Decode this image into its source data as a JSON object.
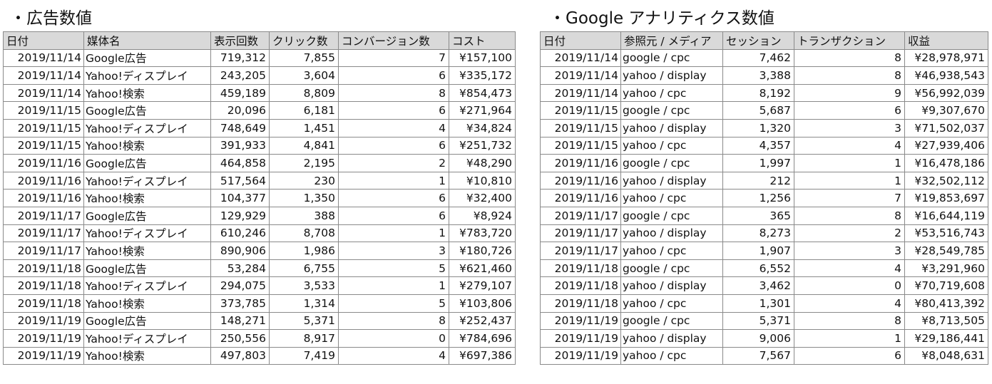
{
  "ads": {
    "title": "・広告数値",
    "headers": [
      "日付",
      "媒体名",
      "表示回数",
      "クリック数",
      "コンバージョン数",
      "コスト"
    ],
    "rows": [
      [
        "2019/11/14",
        "Google広告",
        "719,312",
        "7,855",
        "7",
        "¥157,100"
      ],
      [
        "2019/11/14",
        "Yahoo!ディスプレイ",
        "243,205",
        "3,604",
        "6",
        "¥335,172"
      ],
      [
        "2019/11/14",
        "Yahoo!検索",
        "459,189",
        "8,809",
        "8",
        "¥854,473"
      ],
      [
        "2019/11/15",
        "Google広告",
        "20,096",
        "6,181",
        "6",
        "¥271,964"
      ],
      [
        "2019/11/15",
        "Yahoo!ディスプレイ",
        "748,649",
        "1,451",
        "4",
        "¥34,824"
      ],
      [
        "2019/11/15",
        "Yahoo!検索",
        "391,933",
        "4,841",
        "6",
        "¥251,732"
      ],
      [
        "2019/11/16",
        "Google広告",
        "464,858",
        "2,195",
        "2",
        "¥48,290"
      ],
      [
        "2019/11/16",
        "Yahoo!ディスプレイ",
        "517,564",
        "230",
        "1",
        "¥10,810"
      ],
      [
        "2019/11/16",
        "Yahoo!検索",
        "104,377",
        "1,350",
        "6",
        "¥32,400"
      ],
      [
        "2019/11/17",
        "Google広告",
        "129,929",
        "388",
        "6",
        "¥8,924"
      ],
      [
        "2019/11/17",
        "Yahoo!ディスプレイ",
        "610,246",
        "8,708",
        "1",
        "¥783,720"
      ],
      [
        "2019/11/17",
        "Yahoo!検索",
        "890,906",
        "1,986",
        "3",
        "¥180,726"
      ],
      [
        "2019/11/18",
        "Google広告",
        "53,284",
        "6,755",
        "5",
        "¥621,460"
      ],
      [
        "2019/11/18",
        "Yahoo!ディスプレイ",
        "294,075",
        "3,533",
        "1",
        "¥279,107"
      ],
      [
        "2019/11/18",
        "Yahoo!検索",
        "373,785",
        "1,314",
        "5",
        "¥103,806"
      ],
      [
        "2019/11/19",
        "Google広告",
        "148,271",
        "5,371",
        "8",
        "¥252,437"
      ],
      [
        "2019/11/19",
        "Yahoo!ディスプレイ",
        "250,556",
        "8,917",
        "0",
        "¥784,696"
      ],
      [
        "2019/11/19",
        "Yahoo!検索",
        "497,803",
        "7,419",
        "4",
        "¥697,386"
      ]
    ]
  },
  "ga": {
    "title": "・Google アナリティクス数値",
    "headers": [
      "日付",
      "参照元 / メディア",
      "セッション",
      "トランザクション",
      "収益"
    ],
    "rows": [
      [
        "2019/11/14",
        "google / cpc",
        "7,462",
        "8",
        "¥28,978,971"
      ],
      [
        "2019/11/14",
        "yahoo / display",
        "3,388",
        "8",
        "¥46,938,543"
      ],
      [
        "2019/11/14",
        "yahoo / cpc",
        "8,192",
        "9",
        "¥56,992,039"
      ],
      [
        "2019/11/15",
        "google / cpc",
        "5,687",
        "6",
        "¥9,307,670"
      ],
      [
        "2019/11/15",
        "yahoo / display",
        "1,320",
        "3",
        "¥71,502,037"
      ],
      [
        "2019/11/15",
        "yahoo / cpc",
        "4,357",
        "4",
        "¥27,939,406"
      ],
      [
        "2019/11/16",
        "google / cpc",
        "1,997",
        "1",
        "¥16,478,186"
      ],
      [
        "2019/11/16",
        "yahoo / display",
        "212",
        "1",
        "¥32,502,112"
      ],
      [
        "2019/11/16",
        "yahoo / cpc",
        "1,256",
        "7",
        "¥19,853,697"
      ],
      [
        "2019/11/17",
        "google / cpc",
        "365",
        "8",
        "¥16,644,119"
      ],
      [
        "2019/11/17",
        "yahoo / display",
        "8,273",
        "2",
        "¥53,516,743"
      ],
      [
        "2019/11/17",
        "yahoo / cpc",
        "1,907",
        "3",
        "¥28,549,785"
      ],
      [
        "2019/11/18",
        "google / cpc",
        "6,552",
        "4",
        "¥3,291,960"
      ],
      [
        "2019/11/18",
        "yahoo / display",
        "3,462",
        "0",
        "¥70,719,608"
      ],
      [
        "2019/11/18",
        "yahoo / cpc",
        "1,301",
        "4",
        "¥80,413,392"
      ],
      [
        "2019/11/19",
        "google / cpc",
        "5,371",
        "8",
        "¥8,713,505"
      ],
      [
        "2019/11/19",
        "yahoo / display",
        "9,006",
        "1",
        "¥29,186,441"
      ],
      [
        "2019/11/19",
        "yahoo / cpc",
        "7,567",
        "6",
        "¥8,048,631"
      ]
    ]
  }
}
